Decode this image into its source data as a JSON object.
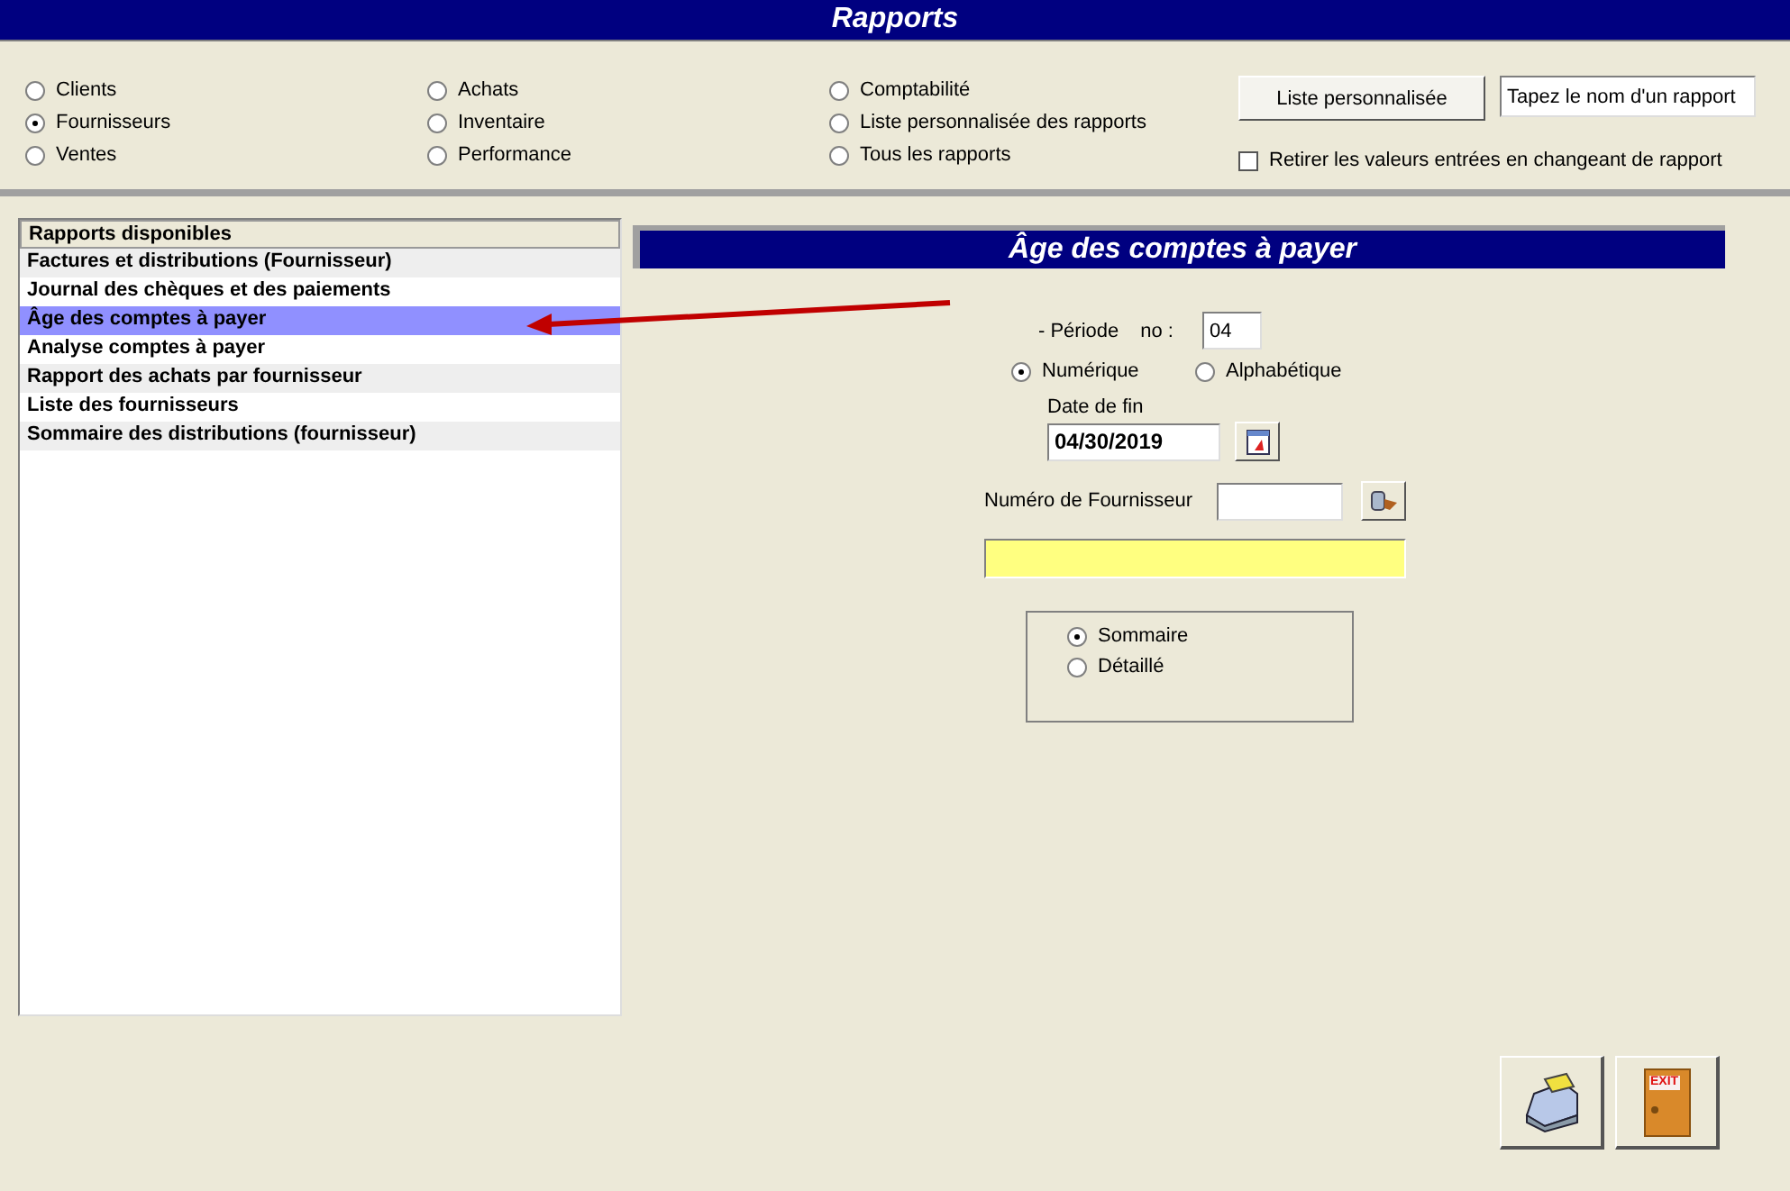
{
  "window": {
    "title": "Rapports"
  },
  "categories": [
    {
      "label": "Clients",
      "selected": false
    },
    {
      "label": "Fournisseurs",
      "selected": true
    },
    {
      "label": "Ventes",
      "selected": false
    },
    {
      "label": "Achats",
      "selected": false
    },
    {
      "label": "Inventaire",
      "selected": false
    },
    {
      "label": "Performance",
      "selected": false
    },
    {
      "label": "Comptabilité",
      "selected": false
    },
    {
      "label": "Liste personnalisée des rapports",
      "selected": false
    },
    {
      "label": "Tous les rapports",
      "selected": false
    }
  ],
  "custom_list_button": "Liste personnalisée",
  "report_name_field": {
    "value": "Tapez le nom d'un rapport"
  },
  "clear_values": {
    "label": "Retirer les valeurs entrées en changeant de rapport",
    "checked": false
  },
  "report_list": {
    "header": "Rapports disponibles",
    "items": [
      {
        "label": "Factures et distributions (Fournisseur)",
        "selected": false
      },
      {
        "label": "Journal des chèques et des paiements",
        "selected": false
      },
      {
        "label": "Âge des comptes à payer",
        "selected": true
      },
      {
        "label": "Analyse comptes à payer",
        "selected": false
      },
      {
        "label": "Rapport des achats par fournisseur",
        "selected": false
      },
      {
        "label": "Liste des fournisseurs",
        "selected": false
      },
      {
        "label": "Sommaire des distributions (fournisseur)",
        "selected": false
      }
    ]
  },
  "form": {
    "title": "Âge des comptes à payer",
    "period_label": "- Période",
    "period_no_label": "no :",
    "period_value": "04",
    "sort_options": [
      {
        "label": "Numérique",
        "selected": true
      },
      {
        "label": "Alphabétique",
        "selected": false
      }
    ],
    "end_date_label": "Date de fin",
    "end_date_value": "04/30/2019",
    "supplier_label": "Numéro de Fournisseur",
    "detail_options": [
      {
        "label": "Sommaire",
        "selected": true
      },
      {
        "label": "Détaillé",
        "selected": false
      }
    ]
  },
  "exit_sign": "EXIT"
}
